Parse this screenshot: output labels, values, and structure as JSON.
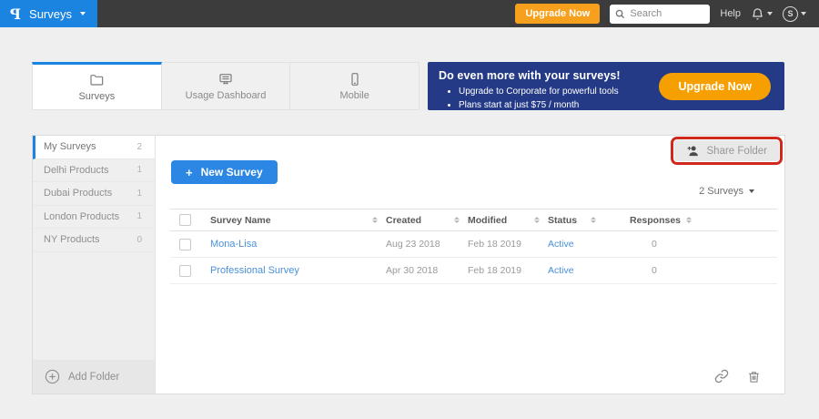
{
  "topbar": {
    "logo_letter": "P",
    "product_menu_label": "Surveys",
    "upgrade_label": "Upgrade Now",
    "search_placeholder": "Search",
    "help_label": "Help",
    "avatar_initial": "S"
  },
  "tabs": [
    {
      "label": "Surveys",
      "active": true
    },
    {
      "label": "Usage Dashboard",
      "active": false
    },
    {
      "label": "Mobile",
      "active": false
    }
  ],
  "banner": {
    "title": "Do even more with your surveys!",
    "bullets": [
      "Upgrade to Corporate for powerful tools",
      "Plans start at just $75 / month"
    ],
    "cta_label": "Upgrade Now"
  },
  "sidebar": {
    "items": [
      {
        "label": "My Surveys",
        "count": "2",
        "active": true
      },
      {
        "label": "Delhi Products",
        "count": "1",
        "active": false
      },
      {
        "label": "Dubai Products",
        "count": "1",
        "active": false
      },
      {
        "label": "London Products",
        "count": "1",
        "active": false
      },
      {
        "label": "NY Products",
        "count": "0",
        "active": false
      }
    ],
    "add_folder_label": "Add Folder"
  },
  "content": {
    "share_folder_label": "Share Folder",
    "new_survey_label": "New Survey",
    "survey_count_label": "2 Surveys",
    "table": {
      "headers": {
        "name": "Survey Name",
        "created": "Created",
        "modified": "Modified",
        "status": "Status",
        "responses": "Responses"
      },
      "rows": [
        {
          "name": "Mona-Lisa",
          "created": "Aug 23 2018",
          "modified": "Feb 18 2019",
          "status": "Active",
          "responses": "0"
        },
        {
          "name": "Professional Survey",
          "created": "Apr 30 2018",
          "modified": "Feb 18 2019",
          "status": "Active",
          "responses": "0"
        }
      ]
    }
  },
  "colors": {
    "brand_blue": "#1a84e0",
    "topbar_gray": "#3d3c3c",
    "banner_navy": "#243a87",
    "orange": "#f7a01d",
    "button_blue": "#2b87e3",
    "link_blue": "#4a90d9",
    "annotation_red": "#d0281c"
  }
}
